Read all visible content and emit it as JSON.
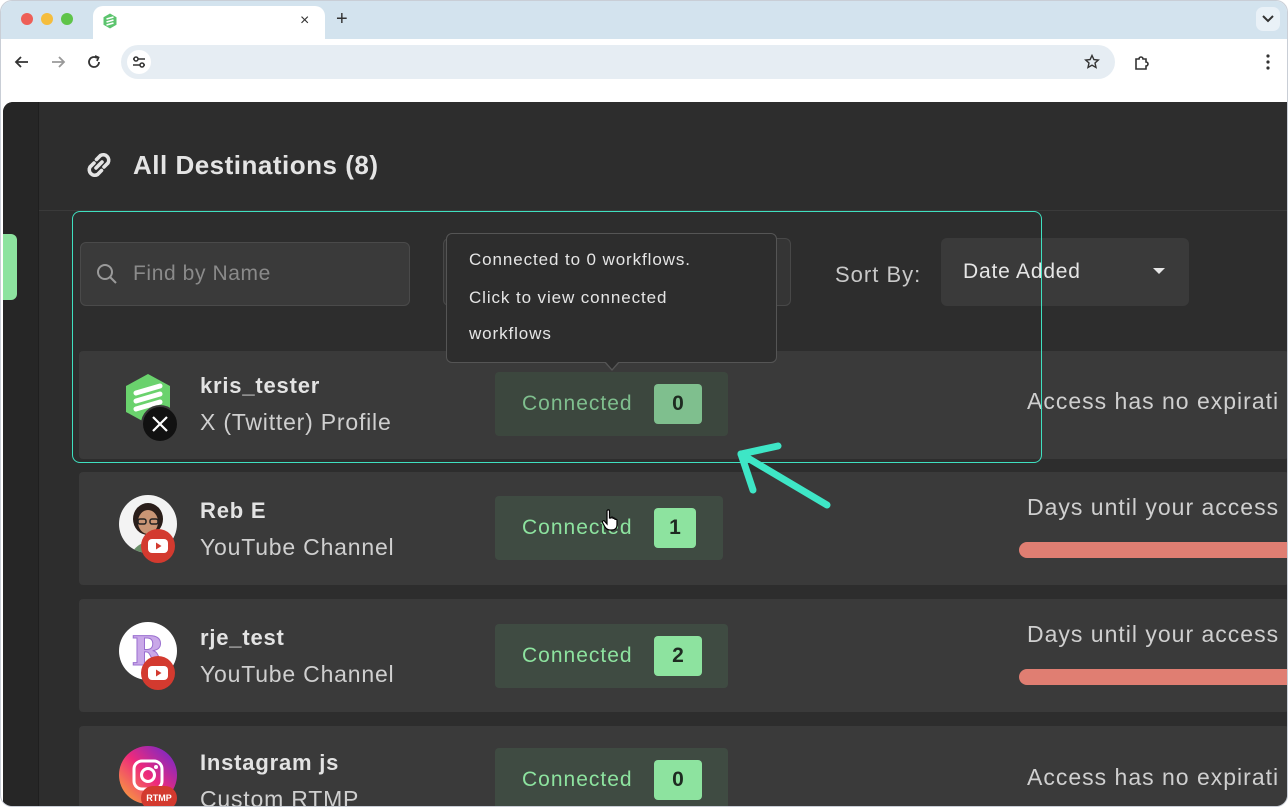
{
  "browser": {
    "tab_close": "×",
    "new_tab": "+",
    "colors": {
      "tabbar": "#d3e3ee",
      "omnibox": "#e6edf3"
    }
  },
  "page": {
    "title": "All Destinations (8)",
    "search_placeholder": "Find by Name",
    "sort_label": "Sort By:",
    "sort_value": "Date Added"
  },
  "tooltip": {
    "lines": [
      "Connected to 0 workflows.",
      "Click to view connected",
      "workflows"
    ]
  },
  "destinations": [
    {
      "name": "kris_tester",
      "type": "X (Twitter) Profile",
      "status": "Connected",
      "count": "0",
      "access": "Access has no expirati",
      "platform_icon": "x-icon"
    },
    {
      "name": "Reb E",
      "type": "YouTube Channel",
      "status": "Connected",
      "count": "1",
      "access": "Days until your access",
      "platform_icon": "youtube-icon"
    },
    {
      "name": "rje_test",
      "type": "YouTube Channel",
      "status": "Connected",
      "count": "2",
      "access": "Days until your access",
      "platform_icon": "youtube-icon",
      "avatar_letter": "R"
    },
    {
      "name": "Instagram js",
      "type": "Custom RTMP",
      "status": "Connected",
      "count": "0",
      "access": "Access has no expirati",
      "platform_icon": "rtmp-icon",
      "badge_text": "RTMP"
    }
  ],
  "colors": {
    "accent_green": "#8de39f",
    "highlight": "#3fe0c0",
    "access_bar": "#e07e72",
    "app_bg": "#2d2d2d"
  }
}
